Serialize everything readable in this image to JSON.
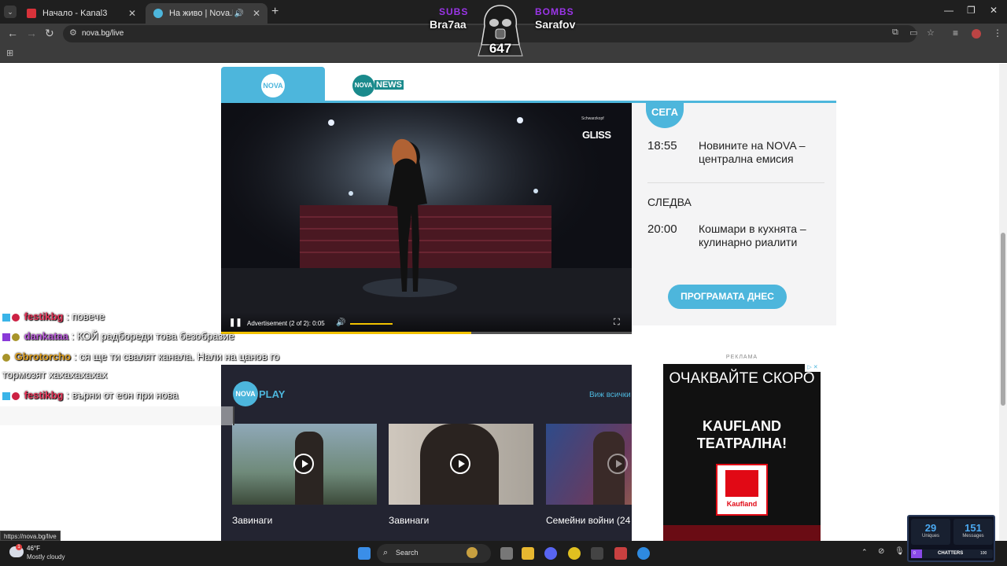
{
  "browser": {
    "tabs": [
      {
        "title": "Начало - Kanal3",
        "active": false
      },
      {
        "title": "На живо | Nova.bg",
        "active": true
      }
    ],
    "url": "nova.bg/live",
    "status_url": "https://nova.bg/live"
  },
  "overlay": {
    "subs_label": "SUBS",
    "subs_name": "Bra7aa",
    "bombs_label": "BOMBS",
    "bombs_name": "Sarafov",
    "count": "647"
  },
  "nova": {
    "player": {
      "brand_small": "Schwarzkopf",
      "brand": "GLISS",
      "ad_text": "Advertisement (2 of 2): 0:05",
      "progress": 0.61
    },
    "schedule": {
      "now_label": "СЕГА",
      "now_time": "18:55",
      "now_title": "Новините на NOVA – централна емисия",
      "next_label": "СЛЕДВА",
      "next_time": "20:00",
      "next_title": "Кошмари в кухнята – кулинарно риалити",
      "button": "ПРОГРАМАТА ДНЕС"
    },
    "ad": {
      "label": "РЕКЛАМА",
      "line1": "ОЧАКВАЙТЕ СКОРО",
      "line2": "KAUFLAND ТЕАТРАЛНА!",
      "logo_text": "Kaufland"
    },
    "play": {
      "see_all": "Виж всички",
      "cards": [
        {
          "title": "Завинаги"
        },
        {
          "title": "Завинаги"
        },
        {
          "title": "Семейни войни (24"
        }
      ]
    }
  },
  "chat": [
    {
      "user": "festikbg",
      "msg": ": повече",
      "color": "#e8365a"
    },
    {
      "user": "dankataa",
      "msg": ": КОЙ радбореди това безобразие",
      "color": "#b85ad8"
    },
    {
      "user": "Gbrotorcho",
      "msg": ": ся ще ти свалят канала. Нали на цанов го",
      "msg2": "тормозят хахахахахах",
      "color": "#e0a020"
    },
    {
      "user": "festikbg",
      "msg": ": върни от еон при нова",
      "color": "#e8365a"
    }
  ],
  "taskbar": {
    "temperature": "46°F",
    "weather": "Mostly cloudy",
    "search": "Search"
  },
  "stats": {
    "uniques": "29",
    "uniques_label": "Uniques",
    "messages": "151",
    "messages_label": "Messages",
    "chatters_label": "CHATTERS",
    "chatters_min": "0",
    "chatters_max": "100"
  }
}
